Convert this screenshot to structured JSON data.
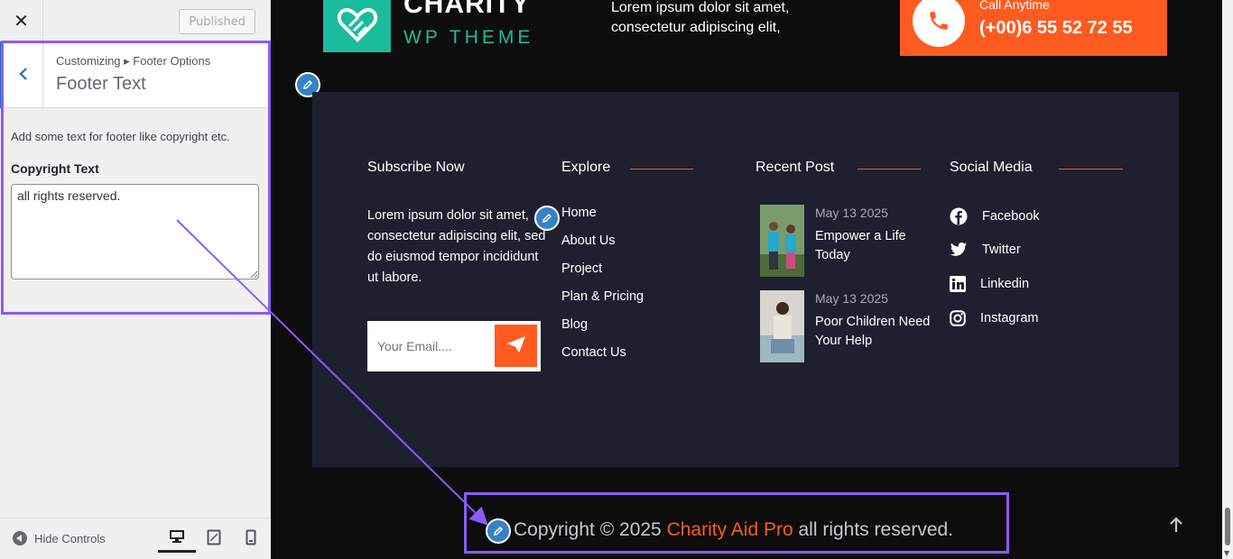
{
  "customizer": {
    "close_icon": "close-icon",
    "publish_label": "Published",
    "breadcrumb": "Customizing ▸ Footer Options",
    "section_title": "Footer Text",
    "description": "Add some text for footer like copyright etc.",
    "field_label": "Copyright Text",
    "field_value": "all rights reserved.",
    "hide_controls_label": "Hide Controls",
    "devices": [
      "desktop",
      "tablet",
      "mobile"
    ],
    "active_device": "desktop"
  },
  "site": {
    "logo_title": "CHARITY",
    "logo_subtitle": "WP THEME",
    "top_text": "Lorem ipsum dolor sit amet, consectetur adipiscing elit,",
    "call_label": "Call Anytime",
    "call_number": "(+00)6 55 52 72 55"
  },
  "footer": {
    "subscribe": {
      "title": "Subscribe Now",
      "text": "Lorem ipsum dolor sit amet, consectetur adipiscing elit, sed do eiusmod tempor incididunt ut labore.",
      "email_placeholder": "Your Email...."
    },
    "explore": {
      "title": "Explore",
      "links": [
        "Home",
        "About Us",
        "Project",
        "Plan & Pricing",
        "Blog",
        "Contact Us"
      ]
    },
    "recent": {
      "title": "Recent Post",
      "posts": [
        {
          "date": "May 13 2025",
          "title": "Empower a Life Today"
        },
        {
          "date": "May 13 2025",
          "title": "Poor Children Need Your Help"
        }
      ]
    },
    "social": {
      "title": "Social Media",
      "items": [
        "Facebook",
        "Twitter",
        "Linkedin",
        "Instagram"
      ]
    }
  },
  "copyright": {
    "prefix": "Copyright © 2025",
    "brand": "Charity Aid Pro",
    "suffix": "all rights reserved."
  },
  "colors": {
    "accent": "#ff5a1f",
    "teal": "#1abc9c",
    "highlight": "#8b5cf6",
    "wp_blue": "#2271b1"
  }
}
